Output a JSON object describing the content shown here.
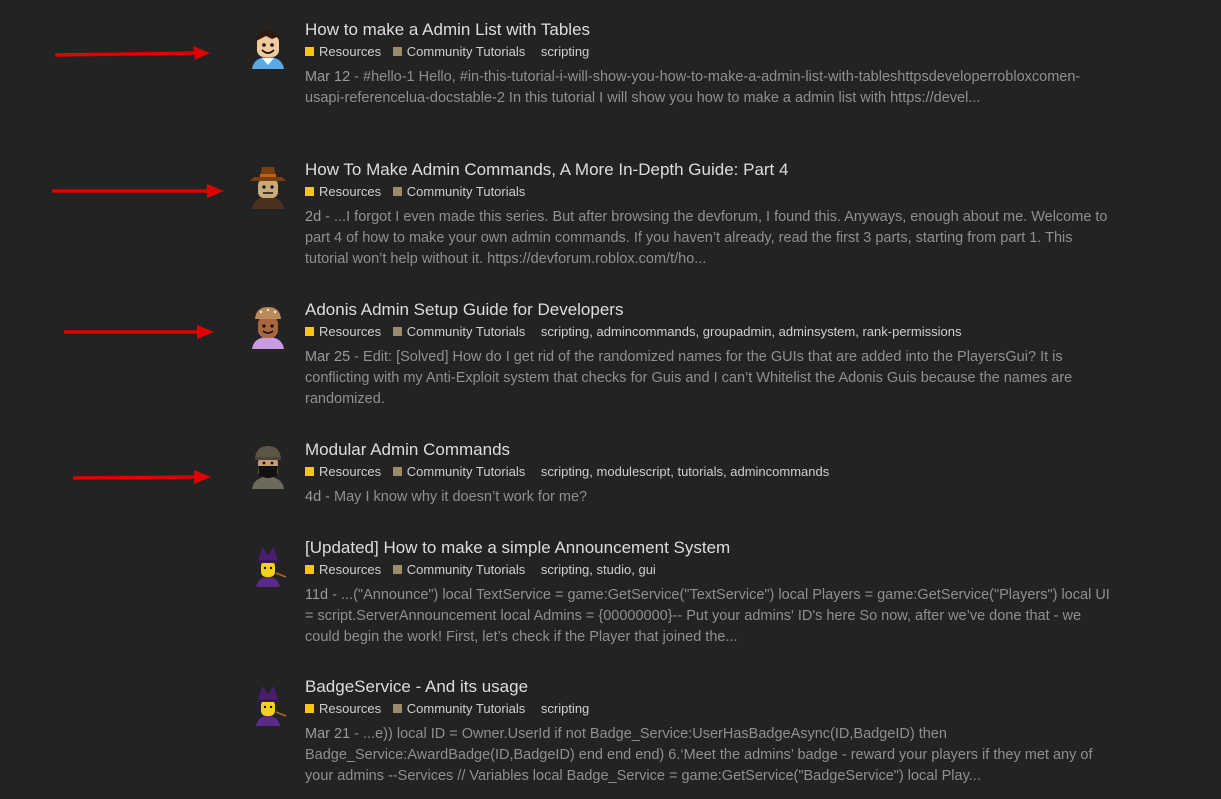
{
  "colors": {
    "background": "#232323",
    "resources_square": "#f5c518",
    "community_tutorials_square": "#9a8b6d",
    "arrow": "#e00000"
  },
  "results": [
    {
      "title": "How to make a Admin List with Tables",
      "categories": [
        "Resources",
        "Community Tutorials"
      ],
      "tags": [
        "scripting"
      ],
      "date": "Mar 12",
      "excerpt": "#hello-1 Hello, #in-this-tutorial-i-will-show-you-how-to-make-a-admin-list-with-tableshttpsdeveloperrobloxcomen-usapi-referencelua-docstable-2 In this tutorial I will show you how to make a admin list with https://devel...",
      "avatar": "classic-smile-avatar-icon"
    },
    {
      "title": "How To Make Admin Commands, A More In-Depth Guide: Part 4",
      "categories": [
        "Resources",
        "Community Tutorials"
      ],
      "tags": [],
      "date": "2d",
      "excerpt": "...I forgot I even made this series. But after browsing the devforum, I found this. Anyways, enough about me. Welcome to part 4 of how to make your own admin commands. If you haven’t already, read the first 3 parts, starting from part 1. This tutorial won’t help without it. https://devforum.roblox.com/t/ho...",
      "avatar": "hat-avatar-icon"
    },
    {
      "title": "Adonis Admin Setup Guide for Developers",
      "categories": [
        "Resources",
        "Community Tutorials"
      ],
      "tags": [
        "scripting",
        "admincommands",
        "groupadmin",
        "adminsystem",
        "rank-permissions"
      ],
      "date": "Mar 25",
      "excerpt": "Edit: [Solved] How do I get rid of the randomized names for the GUIs that are added into the PlayersGui? It is conflicting with my Anti-Exploit system that checks for Guis and I can’t Whitelist the Adonis Guis because the names are randomized.",
      "avatar": "cap-avatar-icon"
    },
    {
      "title": "Modular Admin Commands",
      "categories": [
        "Resources",
        "Community Tutorials"
      ],
      "tags": [
        "scripting",
        "modulescript",
        "tutorials",
        "admincommands"
      ],
      "date": "4d",
      "excerpt": "May I know why it doesn’t work for me?",
      "avatar": "masked-avatar-icon"
    },
    {
      "title": "[Updated] How to make a simple Announcement System",
      "categories": [
        "Resources",
        "Community Tutorials"
      ],
      "tags": [
        "scripting",
        "studio",
        "gui"
      ],
      "date": "11d",
      "excerpt": "...(\"Announce\") local TextService = game:GetService(\"TextService\") local Players = game:GetService(\"Players\") local UI = script.ServerAnnouncement local Admins = {00000000}-- Put your admins' ID's here So now, after we’ve done that - we could begin the work! First, let’s check if the Player that joined the...",
      "avatar": "purple-hat-avatar-icon"
    },
    {
      "title": "BadgeService - And its usage",
      "categories": [
        "Resources",
        "Community Tutorials"
      ],
      "tags": [
        "scripting"
      ],
      "date": "Mar 21",
      "excerpt": "...e)) local ID = Owner.UserId if not Badge_Service:UserHasBadgeAsync(ID,BadgeID) then Badge_Service:AwardBadge(ID,BadgeID) end end end) 6.‘Meet the admins’ badge - reward your players if they met any of your admins --Services // Variables local Badge_Service = game:GetService(\"BadgeService\") local Play...",
      "avatar": "purple-hat-avatar-icon"
    }
  ]
}
